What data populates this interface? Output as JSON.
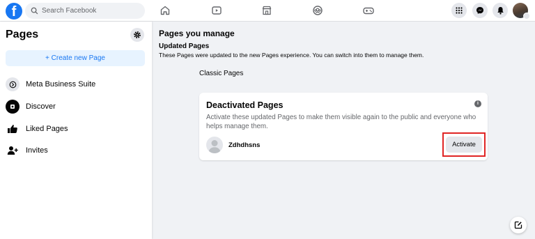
{
  "topbar": {
    "search_placeholder": "Search Facebook",
    "logo_letter": "f",
    "nav_icons": [
      "home-icon",
      "watch-icon",
      "marketplace-icon",
      "groups-icon",
      "gaming-icon"
    ],
    "right_icons": [
      "menu-grid-icon",
      "messenger-icon",
      "notifications-icon",
      "account-avatar"
    ]
  },
  "sidebar": {
    "title": "Pages",
    "create_label": "+ Create new Page",
    "items": [
      {
        "label": "Meta Business Suite",
        "icon": "business-suite-icon"
      },
      {
        "label": "Discover",
        "icon": "discover-icon"
      },
      {
        "label": "Liked Pages",
        "icon": "like-icon"
      },
      {
        "label": "Invites",
        "icon": "invite-icon"
      }
    ]
  },
  "main": {
    "title": "Pages you manage",
    "updated_heading": "Updated Pages",
    "updated_desc": "These Pages were updated to the new Pages experience. You can switch into them to manage them.",
    "classic_label": "Classic Pages",
    "card": {
      "title": "Deactivated Pages",
      "info_glyph": "i",
      "desc": "Activate these updated Pages to make them visible again to the public and everyone who helps manage them.",
      "page_name": "Zdhdhsns",
      "activate_label": "Activate"
    }
  },
  "colors": {
    "brand_blue": "#1877f2",
    "highlight_red": "#e02424",
    "background": "#f0f2f5"
  }
}
